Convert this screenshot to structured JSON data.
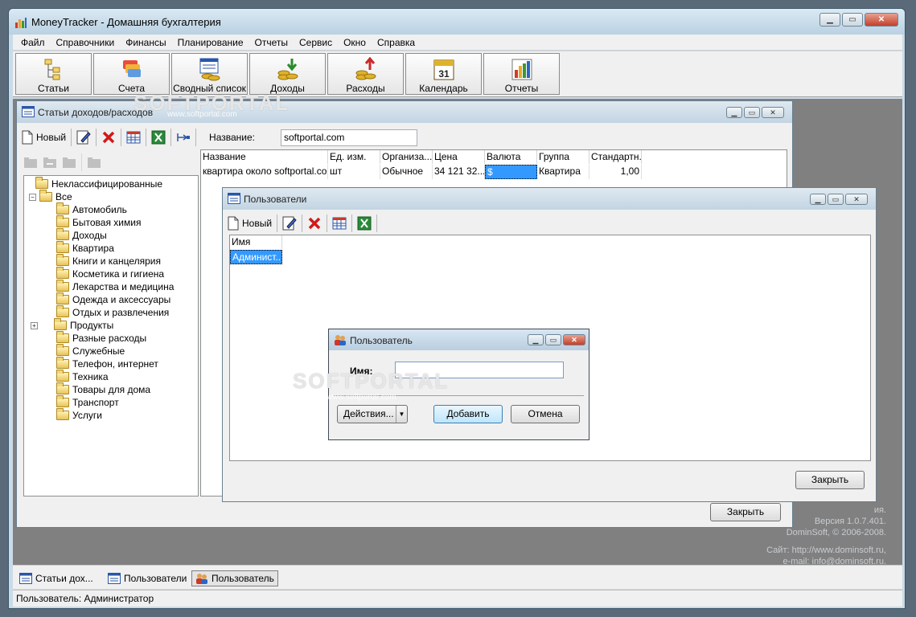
{
  "app": {
    "title": "MoneyTracker - Домашняя бухгалтерия"
  },
  "menu": [
    "Файл",
    "Справочники",
    "Финансы",
    "Планирование",
    "Отчеты",
    "Сервис",
    "Окно",
    "Справка"
  ],
  "toolbar": [
    "Статьи",
    "Счета",
    "Сводный список",
    "Доходы",
    "Расходы",
    "Календарь",
    "Отчеты"
  ],
  "calendar_day": "31",
  "articles": {
    "title": "Статьи доходов/расходов",
    "new_label": "Новый",
    "name_label": "Название:",
    "name_value": "softportal.com",
    "tree": {
      "root_unclassified": "Неклассифицированные",
      "root_all": "Все",
      "children": [
        "Автомобиль",
        "Бытовая химия",
        "Доходы",
        "Квартира",
        "Книги и канцелярия",
        "Косметика и гигиена",
        "Лекарства и медицина",
        "Одежда и аксессуары",
        "Отдых и развлечения",
        "Продукты",
        "Разные расходы",
        "Служебные",
        "Телефон, интернет",
        "Техника",
        "Товары для дома",
        "Транспорт",
        "Услуги"
      ]
    },
    "columns": [
      "Название",
      "Ед. изм.",
      "Организа...",
      "Цена",
      "Валюта",
      "Группа",
      "Стандартн..."
    ],
    "rows": [
      [
        "квартира около softportal.com",
        "шт",
        "Обычное",
        "34 121 32...",
        "$",
        "Квартира",
        "1,00"
      ]
    ],
    "close_label": "Закрыть"
  },
  "users": {
    "title": "Пользователи",
    "new_label": "Новый",
    "column": "Имя",
    "rows": [
      "Админист..."
    ],
    "close_label": "Закрыть"
  },
  "user_dialog": {
    "title": "Пользователь",
    "name_label": "Имя:",
    "name_value": "",
    "actions_label": "Действия...",
    "add_label": "Добавить",
    "cancel_label": "Отмена"
  },
  "info": {
    "partial_line": "ия.",
    "version": "Версия 1.0.7.401.",
    "copyright": "DominSoft, © 2006-2008.",
    "site": "Сайт: http://www.dominsoft.ru,",
    "email": "e-mail: info@dominsoft.ru."
  },
  "watermark": {
    "logo": "SOFTPORTAL",
    "url": "www.softportal.com"
  },
  "taskbar": [
    "Статьи дох...",
    "Пользователи",
    "Пользователь"
  ],
  "status": "Пользователь: Администратор"
}
